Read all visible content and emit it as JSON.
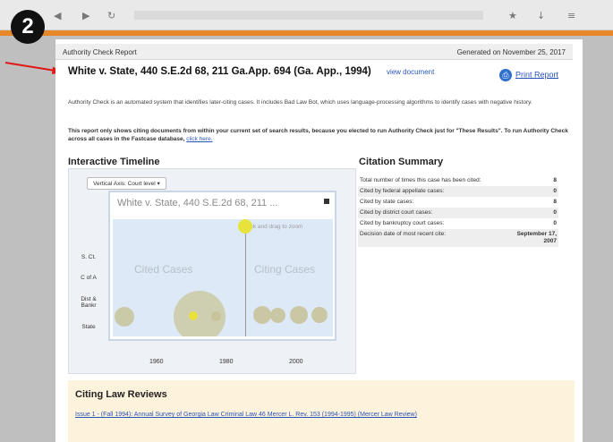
{
  "step": {
    "number": "2"
  },
  "header": {
    "left": "Authority Check Report",
    "right": "Generated on November 25, 2017"
  },
  "case": {
    "title": "White v. State, 440 S.E.2d 68, 211 Ga.App. 694 (Ga. App., 1994)",
    "view_link": "view document"
  },
  "print_label": "Print Report",
  "description": "Authority Check is an automated system that identifies later-citing cases. It includes Bad Law Bot, which uses language-processing algorithms to identify cases with negative history.",
  "note": {
    "text": "This report only shows citing documents from within your current set of search results, because you elected to run Authority Check just for \"These Results\". To run Authority Check across all cases in the Fastcase database,",
    "link": "click here."
  },
  "timeline": {
    "heading": "Interactive Timeline",
    "axis_select": "Vertical Axis: Court level",
    "chart_title": "White v. State, 440 S.E.2d 68, 211 ...",
    "hint": "Click and drag to zoom",
    "cited_label": "Cited Cases",
    "citing_label": "Citing Cases",
    "y_labels": [
      "S. Ct.",
      "C of A",
      "Dist & Bankr",
      "State"
    ],
    "x_ticks": [
      "1960",
      "1980",
      "2000"
    ]
  },
  "summary": {
    "heading": "Citation Summary",
    "rows": [
      {
        "label": "Total number of times this case has been cited:",
        "value": "8"
      },
      {
        "label": "Cited by federal appellate cases:",
        "value": "0"
      },
      {
        "label": "Cited by state cases:",
        "value": "8"
      },
      {
        "label": "Cited by district court cases:",
        "value": "0"
      },
      {
        "label": "Cited by bankruptcy court cases:",
        "value": "0"
      },
      {
        "label": "Decision date of most recent cite:",
        "value": "September 17, 2007"
      }
    ]
  },
  "law_reviews": {
    "heading": "Citing Law Reviews",
    "entry": "Issue 1 - (Fall 1994): Annual Survey of Georgia Law Criminal Law 46 Mercer L. Rev. 153 (1994-1995) (Mercer Law Review)"
  },
  "colors": {
    "accent": "#e6882a",
    "link": "#2a55b8",
    "bubble": "#c8c49a",
    "highlight": "#e8e23c",
    "arrow": "#e01818"
  }
}
